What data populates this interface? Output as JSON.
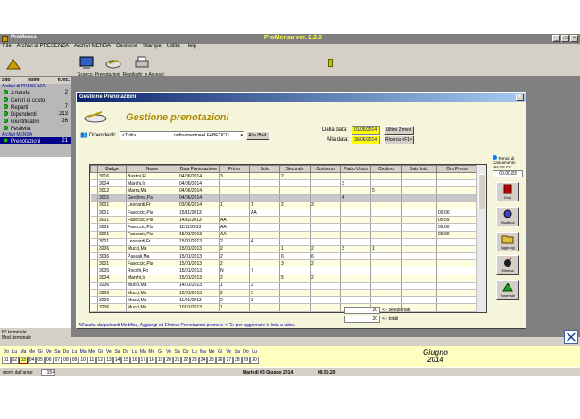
{
  "app": {
    "titlebar_left": "ProMensa",
    "titlebar_center": "ProMensa  ver. 2.2.0",
    "menu": [
      "File",
      "Archivi di PRESENZA",
      "Archivi MENSA",
      "Gestione",
      "Stampe",
      "Utilità",
      "Help"
    ]
  },
  "toolbar": {
    "labels": [
      "Scarico",
      "Prenotazioni",
      "Riepiloghi",
      "e Accessi"
    ]
  },
  "sidebar": {
    "col_sito": "Sito",
    "col_nome": "nome",
    "col_nrec": "n.rec.",
    "section_presenza": "Archivi di PRESENZA",
    "items": [
      {
        "label": "Aziende",
        "count": "2"
      },
      {
        "label": "Centri di costo",
        "count": ""
      },
      {
        "label": "Reparti",
        "count": "7"
      },
      {
        "label": "Dipendenti",
        "count": "213"
      },
      {
        "label": "Giustificativi",
        "count": "26"
      },
      {
        "label": "Festività",
        "count": ""
      }
    ],
    "section_mensa": "Archivi MENSA",
    "mensa_items": [
      {
        "label": "Prenotazioni",
        "count": "21"
      }
    ]
  },
  "dialog": {
    "title": "Gestione Prenotazioni",
    "heading": "Gestione prenotazioni",
    "dipendenti_label": "Dipendenti:",
    "dipendenti_value": "<Tutti>",
    "ordinamento_value": "ordinamento=ALFABETICO",
    "alfa_button": "Alfa./Bad.",
    "dalla_label": "Dalla data:",
    "dalla_value": "01/05/2014",
    "alla_label": "Alla data:",
    "alla_value": "30/06/2014",
    "ultimi_button": "Ultimi 2 mesi",
    "ricerca_button": "Ricerca <F1>",
    "columns": [
      "",
      "Badge",
      "Nome",
      "Data Prenotazione",
      "Primo",
      "Solo",
      "Secondo",
      "Contorno",
      "Piatto Unico",
      "Cestino",
      "Data Imb.",
      "Ora Prenot"
    ],
    "rows": [
      [
        "",
        "3016",
        "Bastini,Fi",
        "04/06/2014",
        "3",
        "",
        "2",
        "",
        "",
        "",
        "",
        ""
      ],
      [
        "",
        "3004",
        "Marchi,Is",
        "04/06/2014",
        "",
        "",
        "",
        "",
        "3",
        "",
        "",
        ""
      ],
      [
        "",
        "3012",
        "Marra,Ma",
        "04/06/2014",
        "",
        "",
        "",
        "",
        "",
        "5",
        "",
        ""
      ],
      [
        "",
        "3015",
        "Gerolimo,Pa",
        "04/06/2014",
        "",
        "",
        "",
        "",
        "4",
        "",
        "",
        ""
      ],
      [
        "",
        "3001",
        "Leonardi,Fr",
        "03/06/2014",
        "1",
        "1",
        "2",
        "3",
        "",
        "",
        "",
        ""
      ],
      [
        "",
        "3001",
        "Fasoccio,Pia",
        "15/11/2013",
        "",
        "AA",
        "",
        "",
        "",
        "",
        "",
        "09:00"
      ],
      [
        "",
        "3001",
        "Fasoccio,Pia",
        "14/11/2013",
        "AA",
        "",
        "",
        "",
        "",
        "",
        "",
        "09:59"
      ],
      [
        "",
        "3001",
        "Fasoccio,Pia",
        "11/11/2013",
        "AA",
        "",
        "",
        "",
        "",
        "",
        "",
        "09:00"
      ],
      [
        "",
        "3001",
        "Fasoccio,Pia",
        "15/01/2013",
        "AA",
        "",
        "",
        "",
        "",
        "",
        "",
        "09:00"
      ],
      [
        "",
        "3001",
        "Leonardi,Fr",
        "15/01/2013",
        "2",
        "4",
        "",
        "",
        "",
        "",
        "",
        ""
      ],
      [
        "",
        "3206",
        "Mucci,Ma",
        "15/01/2013",
        "2",
        "",
        "1",
        "2",
        "3",
        "1",
        "",
        ""
      ],
      [
        "",
        "3006",
        "Pascali,Ma",
        "15/01/2013",
        "2",
        "",
        "6",
        "6",
        "",
        "",
        "",
        ""
      ],
      [
        "",
        "3001",
        "Fasoccio,Pia",
        "15/01/2013",
        "2",
        "",
        "3",
        "2",
        "",
        "",
        "",
        ""
      ],
      [
        "",
        "3005",
        "Rocchi,Ro",
        "15/01/2013",
        "N",
        "7",
        "",
        "",
        "",
        "",
        "",
        ""
      ],
      [
        "",
        "3004",
        "Marchi,Is",
        "15/01/2013",
        "2",
        "",
        "5",
        "2",
        "",
        "",
        "",
        ""
      ],
      [
        "",
        "3206",
        "Mucci,Ma",
        "14/01/2013",
        "1",
        "2",
        "",
        "",
        "",
        "",
        "",
        ""
      ],
      [
        "",
        "3206",
        "Mucci,Ma",
        "12/01/2013",
        "2",
        "3",
        "",
        "",
        "",
        "",
        "",
        ""
      ],
      [
        "",
        "3206",
        "Mucci,Ma",
        "11/01/2013",
        "2",
        "3",
        "",
        "",
        "",
        "",
        "",
        ""
      ],
      [
        "",
        "3206",
        "Mucci,Ma",
        "10/01/2013",
        "1",
        "",
        "",
        "",
        "",
        "",
        "",
        ""
      ]
    ],
    "hint": "All'uscita dai pulsanti Modifica, Aggiungi ed Elimina Prenotazioni premere <F1> per aggiornare la lista a video.",
    "selezionati_count": "20",
    "selezionati_label": "<-- selezionati",
    "totali_count": "20",
    "totali_label": "<-- totali",
    "tempo_label": "Tempo di Caricamento",
    "tempo_sub": "HH:SS.CC",
    "tempo_value": "00.00.83",
    "side_buttons": [
      "Esci",
      "Modifica",
      "Aggiungi",
      "Elimina",
      "Anomale"
    ]
  },
  "status": {
    "terminale": "N° terminale",
    "mod_terminale": "Mod. terminale"
  },
  "calendar": {
    "days": [
      "Do",
      "Lu",
      "Ma",
      "Me",
      "Gi",
      "Ve",
      "Sa",
      "Do",
      "Lu",
      "Ma",
      "Me",
      "Gi",
      "Ve",
      "Sa",
      "Do",
      "Lu",
      "Ma",
      "Me",
      "Gi",
      "Ve",
      "Sa",
      "Do",
      "Lu",
      "Ma",
      "Me",
      "Gi",
      "Ve",
      "Sa",
      "Do",
      "Lu"
    ],
    "nums": [
      "01",
      "02",
      "03",
      "04",
      "05",
      "06",
      "07",
      "08",
      "09",
      "10",
      "11",
      "12",
      "13",
      "14",
      "15",
      "16",
      "17",
      "18",
      "19",
      "20",
      "21",
      "22",
      "23",
      "24",
      "25",
      "26",
      "27",
      "28",
      "29",
      "30"
    ],
    "month": "Giugno",
    "year": "2014"
  },
  "statusbar": {
    "giorni_label": "giorni dall'anno",
    "giorni_value": "154",
    "date": "Martedi 03 Giugno 2014",
    "time": "09.50.20"
  }
}
